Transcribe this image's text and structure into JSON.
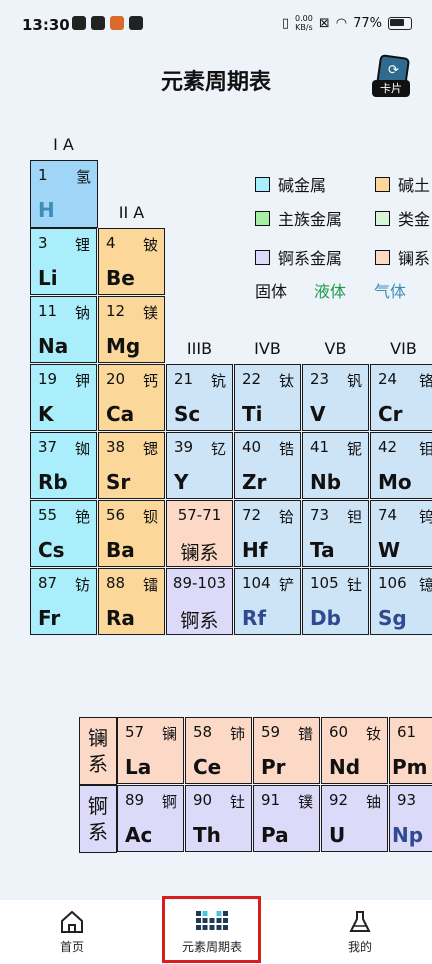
{
  "status": {
    "time": "13:30",
    "net_speed_top": "0.00",
    "net_speed_unit": "KB/s",
    "battery": "77%"
  },
  "header": {
    "title": "元素周期表",
    "card_label": "卡片"
  },
  "groups": {
    "ia": "I A",
    "iia": "II A",
    "iiib": "IIIB",
    "ivb": "IVB",
    "vb": "VB",
    "vib": "VIB"
  },
  "legend": {
    "alkali": "碱金属",
    "alkaline_earth": "碱土",
    "main_group": "主族金属",
    "metalloid": "类金",
    "actinide": "锕系金属",
    "lanthanide": "镧系",
    "solid": "固体",
    "liquid": "液体",
    "gas": "气体"
  },
  "colors": {
    "alkali": "#a9eefa",
    "alkaline_earth": "#fbd79a",
    "transition": "#cde3f6",
    "lanthanide": "#fbd9c6",
    "actinide": "#dcdaf8",
    "hydrogen": "#9fd5f7",
    "main_group": "#a6f0a6",
    "metalloid": "#d8f5d8",
    "liquid_text": "#1e9b4a",
    "gas_text": "#3d8fb8"
  },
  "elements": {
    "h": {
      "num": "1",
      "name": "氢",
      "sym": "H"
    },
    "li": {
      "num": "3",
      "name": "锂",
      "sym": "Li"
    },
    "be": {
      "num": "4",
      "name": "铍",
      "sym": "Be"
    },
    "na": {
      "num": "11",
      "name": "钠",
      "sym": "Na"
    },
    "mg": {
      "num": "12",
      "name": "镁",
      "sym": "Mg"
    },
    "k": {
      "num": "19",
      "name": "钾",
      "sym": "K"
    },
    "ca": {
      "num": "20",
      "name": "钙",
      "sym": "Ca"
    },
    "sc": {
      "num": "21",
      "name": "钪",
      "sym": "Sc"
    },
    "ti": {
      "num": "22",
      "name": "钛",
      "sym": "Ti"
    },
    "v": {
      "num": "23",
      "name": "钒",
      "sym": "V"
    },
    "cr": {
      "num": "24",
      "name": "铬",
      "sym": "Cr"
    },
    "rb": {
      "num": "37",
      "name": "铷",
      "sym": "Rb"
    },
    "sr": {
      "num": "38",
      "name": "锶",
      "sym": "Sr"
    },
    "y": {
      "num": "39",
      "name": "钇",
      "sym": "Y"
    },
    "zr": {
      "num": "40",
      "name": "锆",
      "sym": "Zr"
    },
    "nb": {
      "num": "41",
      "name": "铌",
      "sym": "Nb"
    },
    "mo": {
      "num": "42",
      "name": "钼",
      "sym": "Mo"
    },
    "cs": {
      "num": "55",
      "name": "铯",
      "sym": "Cs"
    },
    "ba": {
      "num": "56",
      "name": "钡",
      "sym": "Ba"
    },
    "lan_series": {
      "num": "57-71",
      "label": "镧系"
    },
    "hf": {
      "num": "72",
      "name": "铪",
      "sym": "Hf"
    },
    "ta": {
      "num": "73",
      "name": "钽",
      "sym": "Ta"
    },
    "w": {
      "num": "74",
      "name": "钨",
      "sym": "W"
    },
    "fr": {
      "num": "87",
      "name": "钫",
      "sym": "Fr"
    },
    "ra": {
      "num": "88",
      "name": "镭",
      "sym": "Ra"
    },
    "act_series": {
      "num": "89-103",
      "label": "锕系"
    },
    "rf": {
      "num": "104",
      "name": "铲",
      "sym": "Rf"
    },
    "db": {
      "num": "105",
      "name": "钍",
      "sym": "Db"
    },
    "sg": {
      "num": "106",
      "name": "镱",
      "sym": "Sg"
    }
  },
  "lanthanides": {
    "head": "镧系",
    "la": {
      "num": "57",
      "name": "镧",
      "sym": "La"
    },
    "ce": {
      "num": "58",
      "name": "铈",
      "sym": "Ce"
    },
    "pr": {
      "num": "59",
      "name": "镨",
      "sym": "Pr"
    },
    "nd": {
      "num": "60",
      "name": "钕",
      "sym": "Nd"
    },
    "pm": {
      "num": "61",
      "name": "",
      "sym": "Pm"
    }
  },
  "actinides": {
    "head": "锕系",
    "ac": {
      "num": "89",
      "name": "锕",
      "sym": "Ac"
    },
    "th": {
      "num": "90",
      "name": "钍",
      "sym": "Th"
    },
    "pa": {
      "num": "91",
      "name": "镤",
      "sym": "Pa"
    },
    "u": {
      "num": "92",
      "name": "铀",
      "sym": "U"
    },
    "np": {
      "num": "93",
      "name": "",
      "sym": "Np"
    }
  },
  "nav": {
    "home": "首页",
    "table": "元素周期表",
    "me": "我的"
  }
}
